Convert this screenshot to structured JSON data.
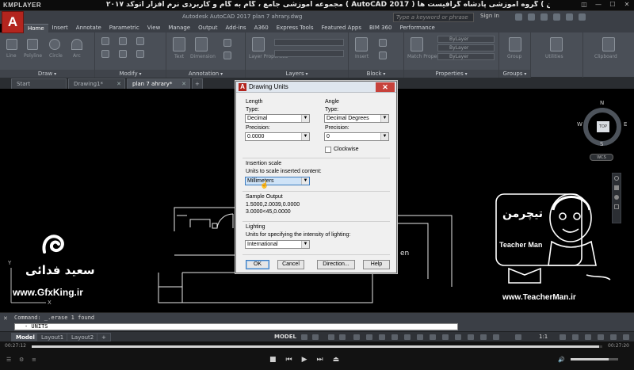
{
  "player": {
    "logo": "KMPLAYER",
    "title": "مجموعه آموزشی جامع ، گام به گام و کاربردی نرم افزار  اتوکد ۲۰۱۷ ( AutoCAD 2017 )   مدرس : سعید فدایی ( تیچرمن ) گروه آموزشی پادشاه گرافیست ها",
    "time_current": "00:27:12",
    "time_total": "00:27:20",
    "progress": 0.995,
    "volume": 0.8
  },
  "acad": {
    "logo_letter": "A",
    "doc_title": "Autodesk AutoCAD 2017    plan 7 ahrary.dwg",
    "search_placeholder": "Type a keyword or phrase",
    "sign_in": "Sign In",
    "ribbon_tabs": [
      "Home",
      "Insert",
      "Annotate",
      "Parametric",
      "View",
      "Manage",
      "Output",
      "Add-ins",
      "A360",
      "Express Tools",
      "Featured Apps",
      "BIM 360",
      "Performance"
    ],
    "active_tab": "Home",
    "ribbon_groups": [
      "Draw",
      "Modify",
      "Annotation",
      "Layers",
      "Block",
      "Properties",
      "Groups"
    ],
    "ribbon_labels": {
      "line": "Line",
      "polyline": "Polyline",
      "circle": "Circle",
      "arc": "Arc",
      "text": "Text",
      "dimension": "Dimension",
      "layer_props": "Layer Properties",
      "insert": "Insert",
      "match_props": "Match Properties",
      "group": "Group",
      "utilities": "Utilities",
      "clipboard": "Clipboard",
      "bylayer": "ByLayer"
    },
    "file_tabs": [
      {
        "label": "Start",
        "closable": false
      },
      {
        "label": "Drawing1*",
        "closable": true
      },
      {
        "label": "plan 7 ahrary*",
        "closable": true
      }
    ],
    "viewcube": {
      "n": "N",
      "s": "S",
      "e": "E",
      "w": "W",
      "top": "TOP",
      "wcs": "WCS"
    },
    "canvas_text": "en",
    "command_history": "Command: _.erase 1 found",
    "command_input": "- UNITS",
    "layout_tabs": [
      "Model",
      "Layout1",
      "Layout2"
    ],
    "active_layout": "Model",
    "status_model": "MODEL",
    "status_scale": "1:1"
  },
  "dialog": {
    "title": "Drawing Units",
    "length": {
      "group_label": "Length",
      "type_label": "Type:",
      "type_value": "Decimal",
      "precision_label": "Precision:",
      "precision_value": "0.0000"
    },
    "angle": {
      "group_label": "Angle",
      "type_label": "Type:",
      "type_value": "Decimal Degrees",
      "precision_label": "Precision:",
      "precision_value": "0",
      "clockwise_label": "Clockwise",
      "clockwise_checked": false
    },
    "insertion": {
      "group_label": "Insertion scale",
      "units_label": "Units to scale inserted content:",
      "units_value": "Millimeters"
    },
    "sample": {
      "group_label": "Sample Output",
      "line1": "1.5000,2.0039,0.0000",
      "line2": "3.0000<45,0.0000"
    },
    "lighting": {
      "group_label": "Lighting",
      "units_label": "Units for specifying the intensity of lighting:",
      "units_value": "International"
    },
    "buttons": {
      "ok": "OK",
      "cancel": "Cancel",
      "direction": "Direction...",
      "help": "Help"
    }
  },
  "watermarks": {
    "left_name": "سعید فدائی",
    "left_url": "www.GfxKing.ir",
    "right_brand_fa": "تیچرمن",
    "right_brand_en": "Teacher Man",
    "right_url": "www.TeacherMan.ir"
  },
  "colors": {
    "autocad_red": "#b3251e",
    "ribbon_bg": "#4a4f57",
    "dialog_bg": "#f0f0f0",
    "selection_blue": "#3b7bbf"
  }
}
